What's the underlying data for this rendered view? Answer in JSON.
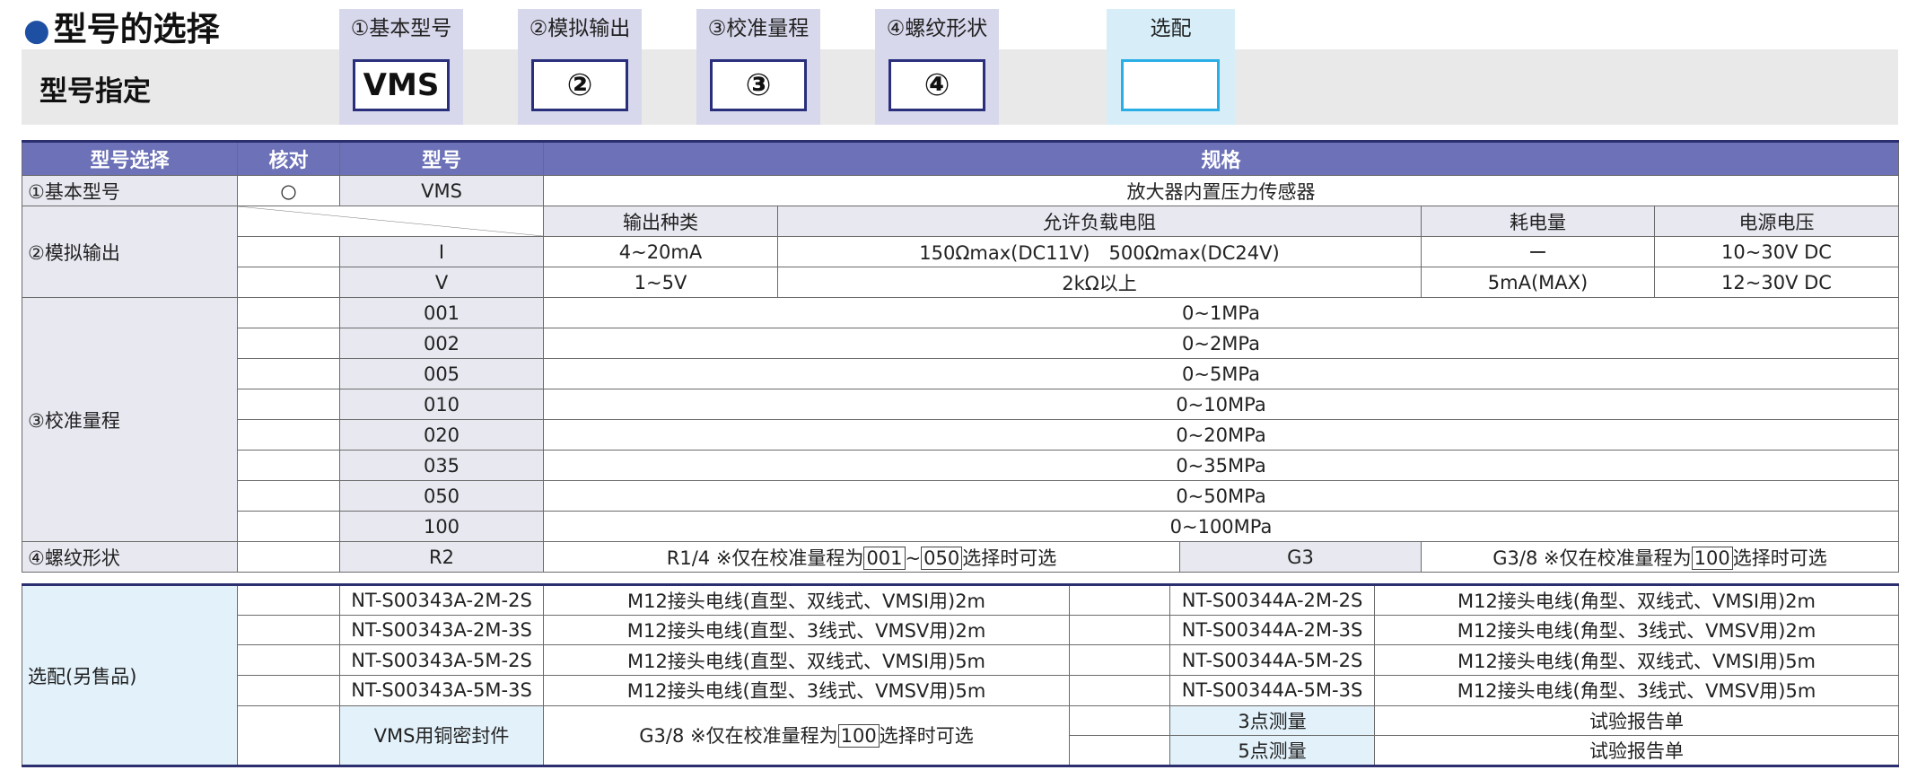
{
  "title": "型号的选择",
  "designation_label": "型号指定",
  "spec_columns": [
    {
      "header": "①基本型号",
      "box": "VMS"
    },
    {
      "header": "②模拟输出",
      "box": "②"
    },
    {
      "header": "③校准量程",
      "box": "③"
    },
    {
      "header": "④螺纹形状",
      "box": "④"
    },
    {
      "header": "选配",
      "box": ""
    }
  ],
  "table": {
    "headers": [
      "型号选择",
      "核对",
      "型号",
      "规格"
    ],
    "basic": {
      "label": "①基本型号",
      "check": "○",
      "model": "VMS",
      "spec": "放大器内置压力传感器"
    },
    "analog": {
      "label": "②模拟输出",
      "subheaders": [
        "输出种类",
        "允许负载电阻",
        "耗电量",
        "电源电压"
      ],
      "rows": [
        {
          "model": "I",
          "type": "4~20mA",
          "load": "150Ωmax(DC11V)　500Ωmax(DC24V)",
          "power": "ー",
          "voltage": "10~30V DC"
        },
        {
          "model": "V",
          "type": "1~5V",
          "load": "2kΩ以上",
          "power": "5mA(MAX)",
          "voltage": "12~30V DC"
        }
      ]
    },
    "range": {
      "label": "③校准量程",
      "rows": [
        {
          "model": "001",
          "spec": "0~1MPa"
        },
        {
          "model": "002",
          "spec": "0~2MPa"
        },
        {
          "model": "005",
          "spec": "0~5MPa"
        },
        {
          "model": "010",
          "spec": "0~10MPa"
        },
        {
          "model": "020",
          "spec": "0~20MPa"
        },
        {
          "model": "035",
          "spec": "0~35MPa"
        },
        {
          "model": "050",
          "spec": "0~50MPa"
        },
        {
          "model": "100",
          "spec": "0~100MPa"
        }
      ]
    },
    "thread": {
      "label": "④螺纹形状",
      "r_model": "R2",
      "r_text_a": "R1/4 ※仅在校准量程为",
      "r_box_1": "001",
      "r_tilde": "~",
      "r_box_2": "050",
      "r_text_b": "选择时可选",
      "g_model": "G3",
      "g_text_a": "G3/8 ※仅在校准量程为",
      "g_box": "100",
      "g_text_b": "选择时可选"
    }
  },
  "options": {
    "label": "选配(另售品)",
    "cables": [
      {
        "left_code": "NT-S00343A-2M-2S",
        "left_desc": "M12接头电线(直型、双线式、VMSI用)2m",
        "right_code": "NT-S00344A-2M-2S",
        "right_desc": "M12接头电线(角型、双线式、VMSI用)2m"
      },
      {
        "left_code": "NT-S00343A-2M-3S",
        "left_desc": "M12接头电线(直型、3线式、VMSV用)2m",
        "right_code": "NT-S00344A-2M-3S",
        "right_desc": "M12接头电线(角型、3线式、VMSV用)2m"
      },
      {
        "left_code": "NT-S00343A-5M-2S",
        "left_desc": "M12接头电线(直型、双线式、VMSI用)5m",
        "right_code": "NT-S00344A-5M-2S",
        "right_desc": "M12接头电线(角型、双线式、VMSI用)5m"
      },
      {
        "left_code": "NT-S00343A-5M-3S",
        "left_desc": "M12接头电线(直型、3线式、VMSV用)5m",
        "right_code": "NT-S00344A-5M-3S",
        "right_desc": "M12接头电线(角型、3线式、VMSV用)5m"
      }
    ],
    "seal": {
      "code": "VMS用铜密封件",
      "text_a": "G3/8 ※仅在校准量程为",
      "box": "100",
      "text_b": "选择时可选"
    },
    "reports": [
      {
        "code": "3点测量",
        "desc": "试验报告单"
      },
      {
        "code": "5点测量",
        "desc": "试验报告单"
      }
    ]
  }
}
